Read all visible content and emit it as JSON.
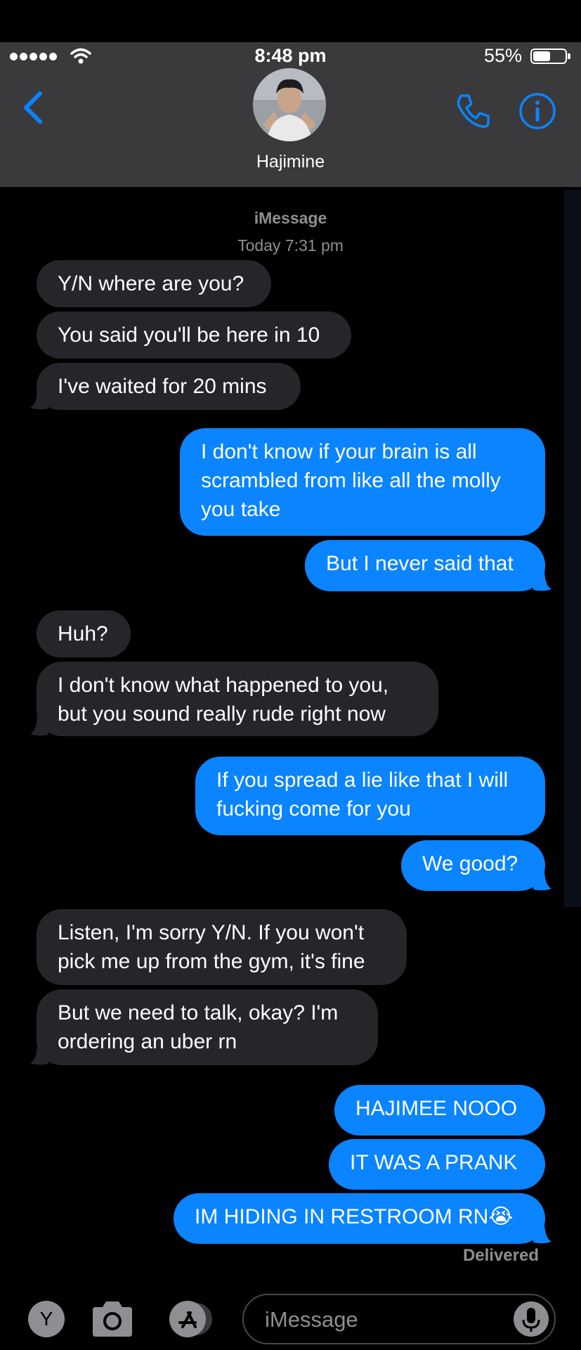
{
  "status_bar": {
    "time": "8:48 pm",
    "battery_percent": "55%",
    "battery_level": 0.55
  },
  "header": {
    "contact_name": "Hajimine"
  },
  "thread": {
    "service": "iMessage",
    "timestamp": "Today 7:31 pm",
    "messages": [
      {
        "from": "them",
        "lines": [
          "Y/N where are you?"
        ]
      },
      {
        "from": "them",
        "lines": [
          "You said you'll be here in 10"
        ]
      },
      {
        "from": "them",
        "lines": [
          "I've waited for 20 mins"
        ]
      },
      {
        "from": "me",
        "lines": [
          "I don't know if your brain is all",
          "scrambled from like all the molly",
          "you take"
        ]
      },
      {
        "from": "me",
        "lines": [
          "But I never said that"
        ]
      },
      {
        "from": "them",
        "lines": [
          "Huh?"
        ]
      },
      {
        "from": "them",
        "lines": [
          "I don't know what happened to you,",
          "but you sound really rude right now"
        ]
      },
      {
        "from": "me",
        "lines": [
          "If you spread a lie like that I will",
          "fucking come for you"
        ]
      },
      {
        "from": "me",
        "lines": [
          "We good?"
        ]
      },
      {
        "from": "them",
        "lines": [
          "Listen, I'm sorry Y/N. If you won't",
          "pick me up from the gym, it's fine"
        ]
      },
      {
        "from": "them",
        "lines": [
          "But we need to talk, okay? I'm",
          "ordering an uber rn"
        ]
      },
      {
        "from": "me",
        "lines": [
          "HAJIMEE NOOO"
        ]
      },
      {
        "from": "me",
        "lines": [
          "IT WAS A PRANK"
        ]
      },
      {
        "from": "me",
        "lines": [
          "IM HIDING IN RESTROOM RN😭"
        ]
      }
    ],
    "delivered": "Delivered"
  },
  "input": {
    "apps_label": "Y",
    "placeholder": "iMessage"
  },
  "colors": {
    "outgoing": "#0a84ff",
    "incoming": "#26252a",
    "accent": "#0a84ff",
    "header_bg": "#3a3a3c"
  },
  "icons": [
    "signal-dots-icon",
    "wifi-icon",
    "battery-icon",
    "back-chevron-icon",
    "phone-icon",
    "info-icon",
    "camera-icon",
    "app-store-icon",
    "microphone-icon"
  ]
}
